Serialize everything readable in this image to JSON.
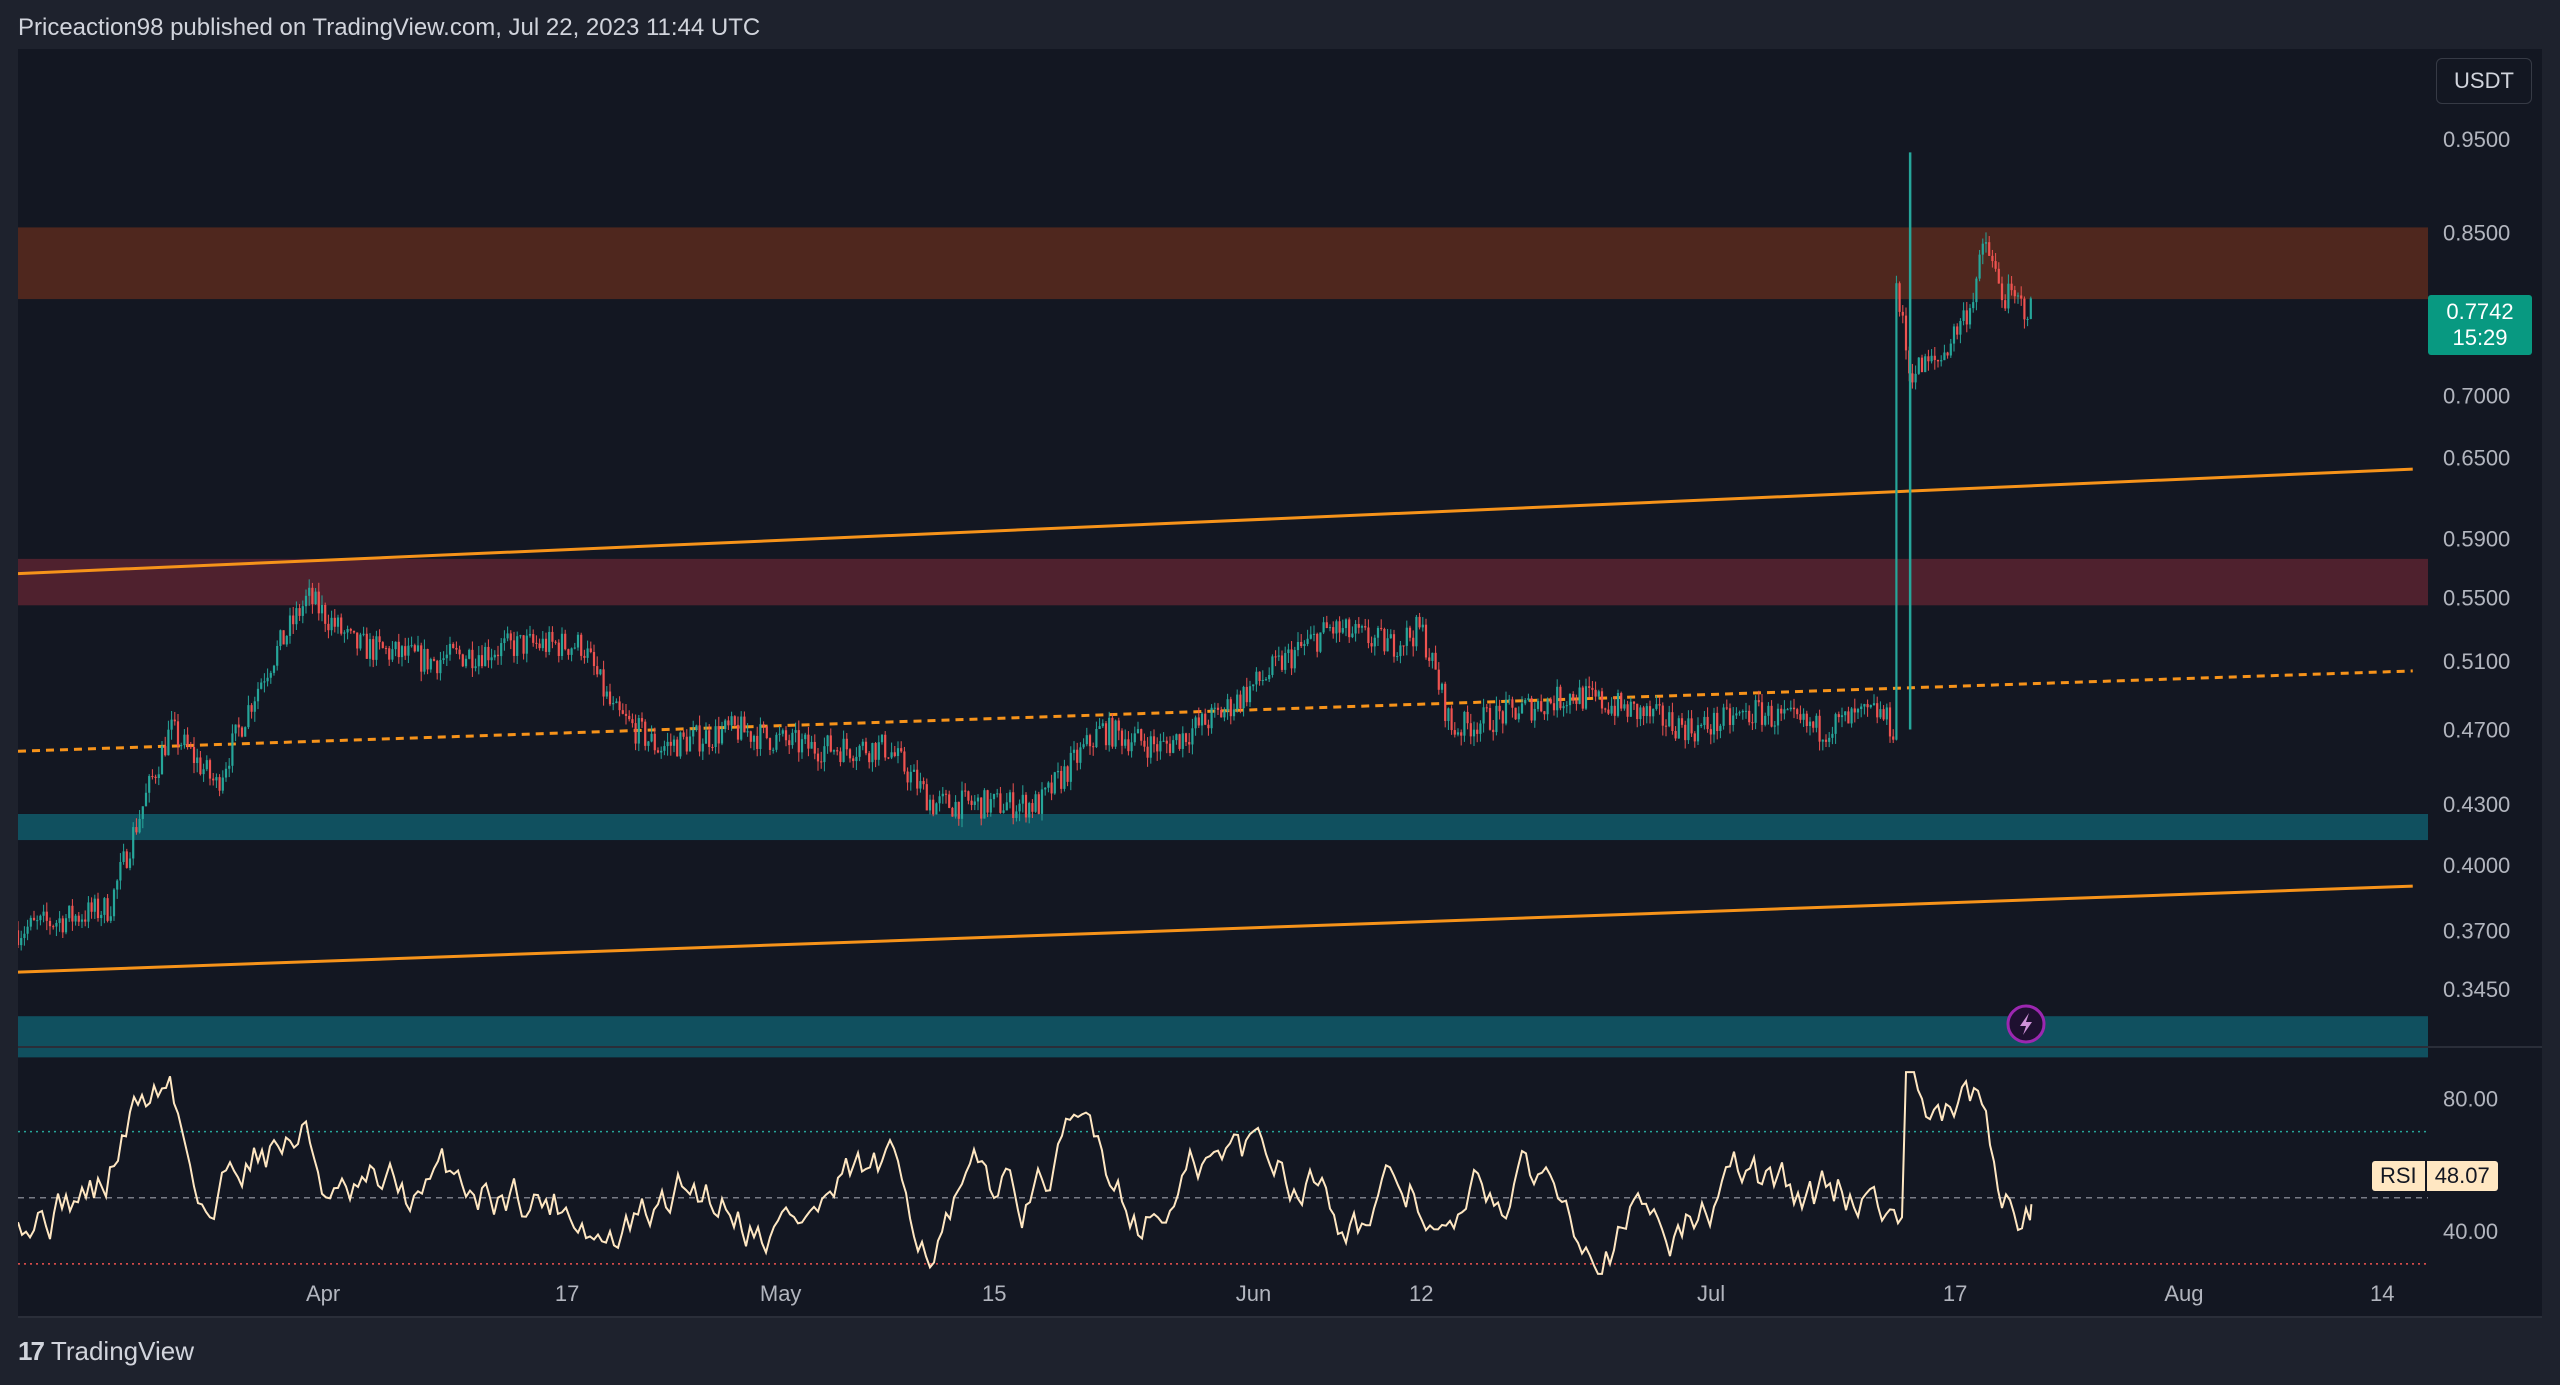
{
  "header": {
    "published": "Priceaction98 published on TradingView.com, Jul 22, 2023 11:44 UTC"
  },
  "currency": "USDT",
  "price_axis": [
    "0.9500",
    "0.8500",
    "0.7000",
    "0.6500",
    "0.5900",
    "0.5500",
    "0.5100",
    "0.4700",
    "0.4300",
    "0.4000",
    "0.3700",
    "0.3450"
  ],
  "last_price": {
    "value": "0.7742",
    "countdown": "15:29"
  },
  "time_axis": [
    "Apr",
    "17",
    "May",
    "15",
    "Jun",
    "12",
    "Jul",
    "17",
    "Aug",
    "14"
  ],
  "rsi": {
    "label": "RSI",
    "value": "48.07",
    "levels": [
      "80.00",
      "40.00"
    ]
  },
  "footer": {
    "brand": "TradingView"
  },
  "colors": {
    "resistance_zone": "#5a2a1d",
    "supply_zone": "#5b2330",
    "support_zone": "#105a6a",
    "trendline": "#f7931a",
    "up_candle": "#26a69a",
    "down_candle": "#ef5350",
    "rsi_line": "#ffe7c2"
  },
  "chart_data": {
    "type": "candlestick",
    "symbol_quote": "USDT",
    "x_range": [
      "2023-03-12",
      "2023-08-17"
    ],
    "y_range": [
      0.33,
      1.0
    ],
    "zones": [
      {
        "kind": "resistance",
        "from": 0.785,
        "to": 0.855
      },
      {
        "kind": "supply",
        "from": 0.545,
        "to": 0.576
      },
      {
        "kind": "support",
        "from": 0.412,
        "to": 0.425
      },
      {
        "kind": "support",
        "from": 0.318,
        "to": 0.334
      }
    ],
    "trendlines": [
      {
        "style": "solid",
        "from": [
          "2023-03-12",
          0.566
        ],
        "to": [
          "2023-08-16",
          0.641
        ]
      },
      {
        "style": "dashed",
        "from": [
          "2023-03-12",
          0.458
        ],
        "to": [
          "2023-08-16",
          0.504
        ]
      },
      {
        "style": "solid",
        "from": [
          "2023-03-12",
          0.352
        ],
        "to": [
          "2023-08-16",
          0.39
        ]
      }
    ],
    "price_path": [
      [
        "2023-03-12",
        0.37
      ],
      [
        "2023-03-18",
        0.38
      ],
      [
        "2023-03-22",
        0.47
      ],
      [
        "2023-03-25",
        0.44
      ],
      [
        "2023-03-28",
        0.5
      ],
      [
        "2023-03-31",
        0.55
      ],
      [
        "2023-04-03",
        0.52
      ],
      [
        "2023-04-08",
        0.51
      ],
      [
        "2023-04-14",
        0.52
      ],
      [
        "2023-04-18",
        0.52
      ],
      [
        "2023-04-20",
        0.48
      ],
      [
        "2023-04-23",
        0.46
      ],
      [
        "2023-04-28",
        0.47
      ],
      [
        "2023-05-03",
        0.46
      ],
      [
        "2023-05-08",
        0.46
      ],
      [
        "2023-05-11",
        0.43
      ],
      [
        "2023-05-15",
        0.43
      ],
      [
        "2023-05-18",
        0.43
      ],
      [
        "2023-05-22",
        0.47
      ],
      [
        "2023-05-26",
        0.46
      ],
      [
        "2023-05-30",
        0.48
      ],
      [
        "2023-06-03",
        0.51
      ],
      [
        "2023-06-06",
        0.53
      ],
      [
        "2023-06-10",
        0.52
      ],
      [
        "2023-06-12",
        0.53
      ],
      [
        "2023-06-14",
        0.47
      ],
      [
        "2023-06-18",
        0.48
      ],
      [
        "2023-06-22",
        0.49
      ],
      [
        "2023-06-26",
        0.48
      ],
      [
        "2023-06-30",
        0.47
      ],
      [
        "2023-07-04",
        0.48
      ],
      [
        "2023-07-08",
        0.47
      ],
      [
        "2023-07-12",
        0.48
      ],
      [
        "2023-07-13",
        0.47
      ],
      [
        "2023-07-13",
        0.81
      ],
      [
        "2023-07-14",
        0.72
      ],
      [
        "2023-07-16",
        0.73
      ],
      [
        "2023-07-18",
        0.78
      ],
      [
        "2023-07-19",
        0.84
      ],
      [
        "2023-07-20",
        0.79
      ],
      [
        "2023-07-22",
        0.7742
      ]
    ],
    "spike_high": {
      "date": "2023-07-13",
      "value": 0.935
    },
    "indicator": {
      "name": "RSI",
      "last": 48.07,
      "overbought": 70,
      "oversold": 30,
      "y_range": [
        20,
        95
      ]
    }
  }
}
